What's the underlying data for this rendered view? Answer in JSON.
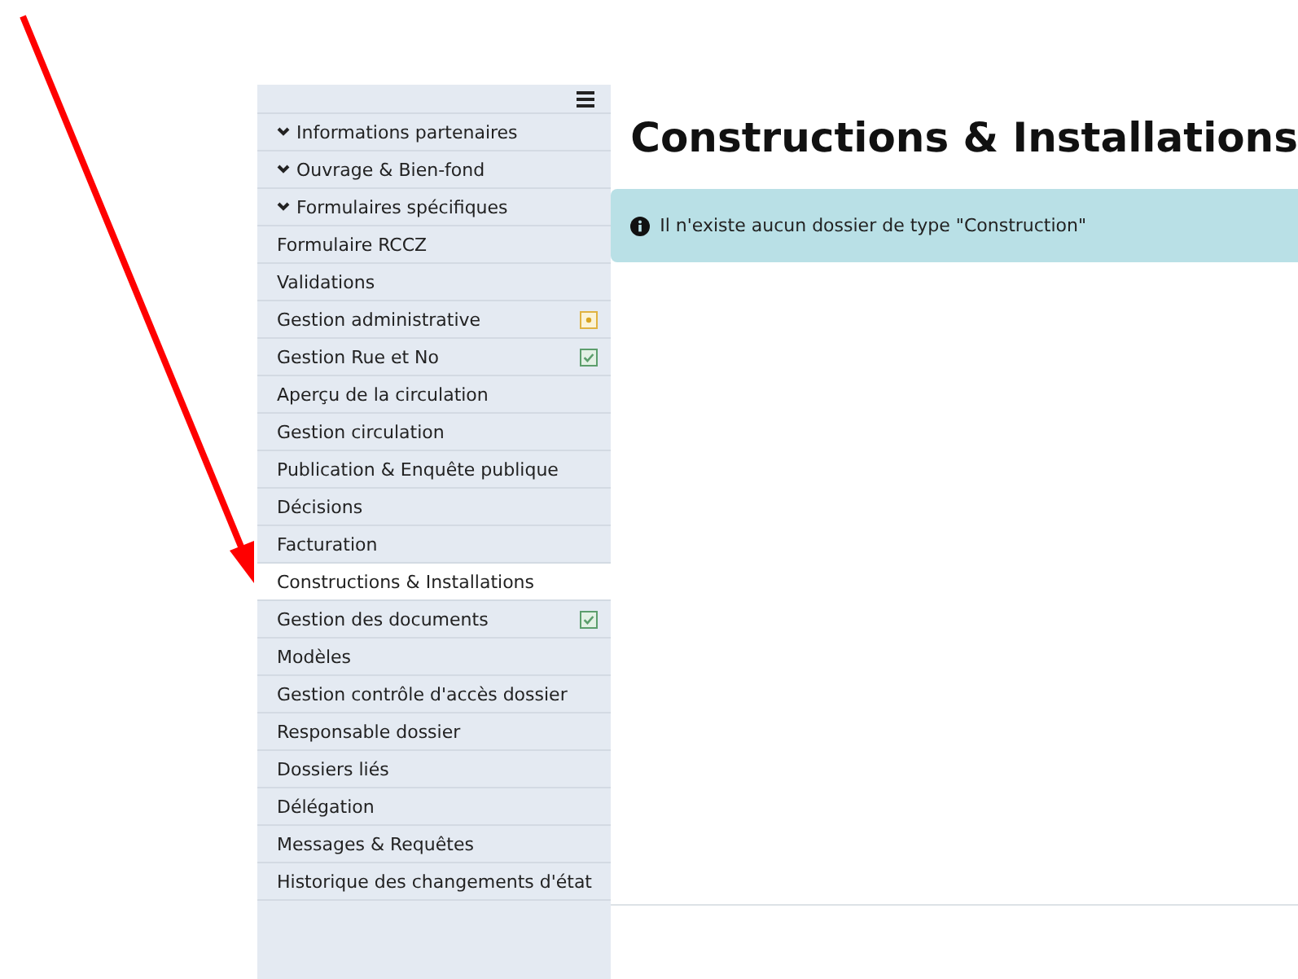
{
  "sidebar": {
    "items": [
      {
        "kind": "group",
        "label": "Informations partenaires",
        "selected": false,
        "pending": false,
        "done": false
      },
      {
        "kind": "group",
        "label": "Ouvrage & Bien-fond",
        "selected": false,
        "pending": false,
        "done": false
      },
      {
        "kind": "group",
        "label": "Formulaires spécifiques",
        "selected": false,
        "pending": false,
        "done": false
      },
      {
        "kind": "link",
        "label": "Formulaire RCCZ",
        "selected": false,
        "pending": false,
        "done": false
      },
      {
        "kind": "link",
        "label": "Validations",
        "selected": false,
        "pending": false,
        "done": false
      },
      {
        "kind": "link",
        "label": "Gestion administrative",
        "selected": false,
        "pending": true,
        "done": false
      },
      {
        "kind": "link",
        "label": "Gestion Rue et No",
        "selected": false,
        "pending": false,
        "done": true
      },
      {
        "kind": "link",
        "label": "Aperçu de la circulation",
        "selected": false,
        "pending": false,
        "done": false
      },
      {
        "kind": "link",
        "label": "Gestion circulation",
        "selected": false,
        "pending": false,
        "done": false
      },
      {
        "kind": "link",
        "label": "Publication & Enquête publique",
        "selected": false,
        "pending": false,
        "done": false
      },
      {
        "kind": "link",
        "label": "Décisions",
        "selected": false,
        "pending": false,
        "done": false
      },
      {
        "kind": "link",
        "label": "Facturation",
        "selected": false,
        "pending": false,
        "done": false
      },
      {
        "kind": "link",
        "label": "Constructions & Installations",
        "selected": true,
        "pending": false,
        "done": false
      },
      {
        "kind": "link",
        "label": "Gestion des documents",
        "selected": false,
        "pending": false,
        "done": true
      },
      {
        "kind": "link",
        "label": "Modèles",
        "selected": false,
        "pending": false,
        "done": false
      },
      {
        "kind": "link",
        "label": "Gestion contrôle d'accès dossier",
        "selected": false,
        "pending": false,
        "done": false
      },
      {
        "kind": "link",
        "label": "Responsable dossier",
        "selected": false,
        "pending": false,
        "done": false
      },
      {
        "kind": "link",
        "label": "Dossiers liés",
        "selected": false,
        "pending": false,
        "done": false
      },
      {
        "kind": "link",
        "label": "Délégation",
        "selected": false,
        "pending": false,
        "done": false
      },
      {
        "kind": "link",
        "label": "Messages & Requêtes",
        "selected": false,
        "pending": false,
        "done": false
      },
      {
        "kind": "link",
        "label": "Historique des changements d'état",
        "selected": false,
        "pending": false,
        "done": false
      }
    ]
  },
  "main": {
    "title": "Constructions & Installations",
    "alert": "Il n'existe aucun dossier de type \"Construction\""
  }
}
